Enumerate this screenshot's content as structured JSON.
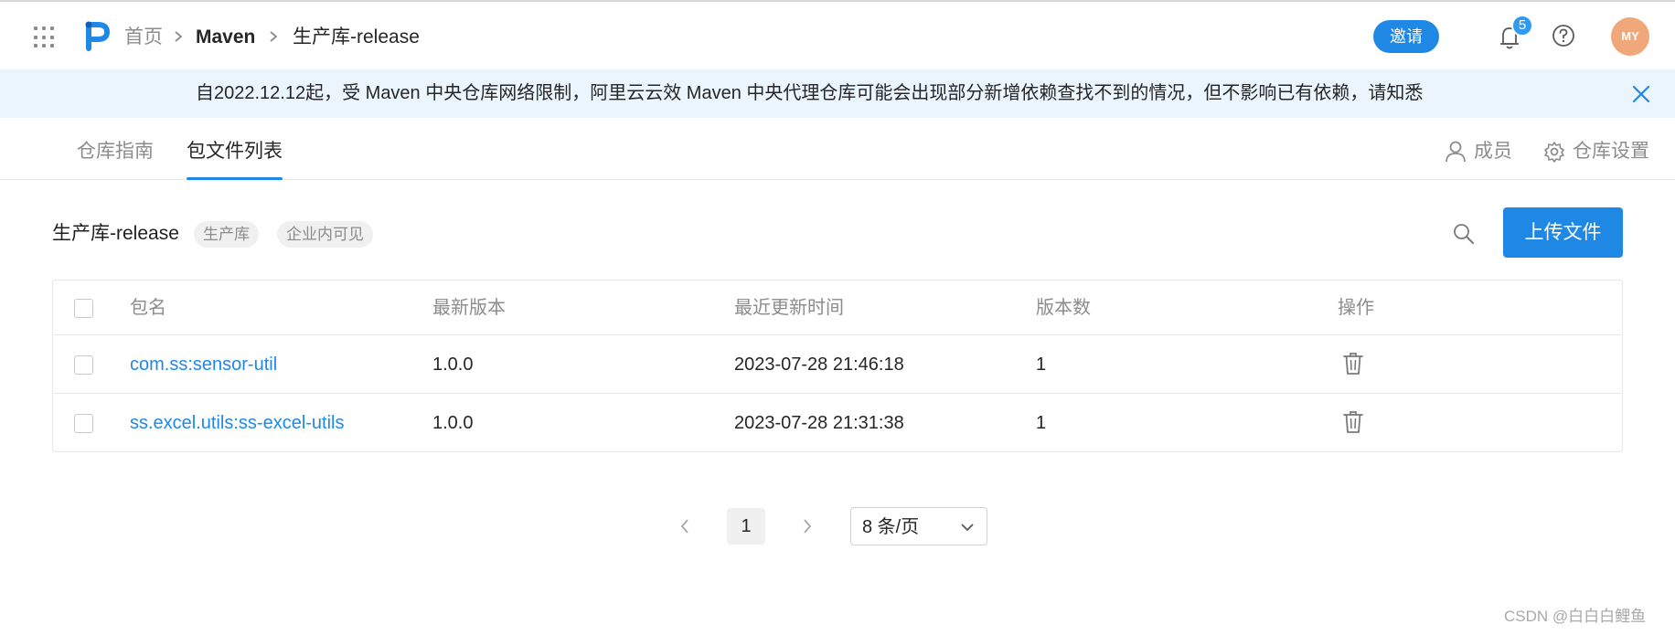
{
  "header": {
    "breadcrumb": [
      "首页",
      "Maven",
      "生产库-release"
    ],
    "invite_label": "邀请",
    "notification_count": "5",
    "avatar_initials": "MY"
  },
  "notice": {
    "text": "自2022.12.12起，受 Maven 中央仓库网络限制，阿里云云效 Maven 中央代理仓库可能会出现部分新增依赖查找不到的情况，但不影响已有依赖，请知悉"
  },
  "tabs": {
    "left": [
      "仓库指南",
      "包文件列表"
    ],
    "active": "包文件列表",
    "members_label": "成员",
    "settings_label": "仓库设置"
  },
  "repo": {
    "name": "生产库-release",
    "tags": [
      "生产库",
      "企业内可见"
    ],
    "upload_label": "上传文件"
  },
  "table": {
    "columns": [
      "包名",
      "最新版本",
      "最近更新时间",
      "版本数",
      "操作"
    ],
    "rows": [
      {
        "name": "com.ss:sensor-util",
        "version": "1.0.0",
        "updated": "2023-07-28 21:46:18",
        "count": "1"
      },
      {
        "name": "ss.excel.utils:ss-excel-utils",
        "version": "1.0.0",
        "updated": "2023-07-28 21:31:38",
        "count": "1"
      }
    ]
  },
  "pagination": {
    "current_page": "1",
    "page_size_label": "8 条/页"
  },
  "watermark": "CSDN @白白白鲤鱼",
  "colors": {
    "accent": "#1f88e5",
    "notice_bg": "#eaf5fd",
    "avatar_bg": "#f0a77a"
  }
}
